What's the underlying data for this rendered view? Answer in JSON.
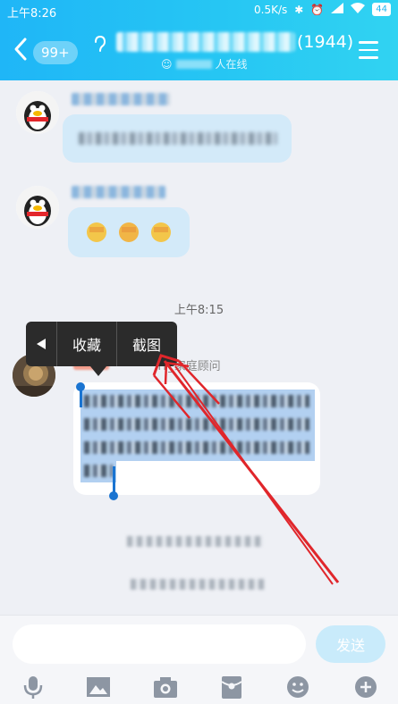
{
  "status_bar": {
    "time": "上午8:26",
    "network_speed": "0.5K/s",
    "battery": "44"
  },
  "header": {
    "back_badge": "99+",
    "member_count": "(1944)",
    "online_text": "人在线"
  },
  "chat": {
    "time_separator": "上午8:15",
    "sender_name_suffix": ":IT_家庭顾问"
  },
  "context_menu": {
    "items": [
      "收藏",
      "截图"
    ]
  },
  "input_bar": {
    "placeholder": "",
    "send_label": "发送"
  },
  "icons": {
    "tools": [
      "microphone-icon",
      "image-icon",
      "camera-icon",
      "red-packet-icon",
      "emoji-icon",
      "plus-icon"
    ]
  },
  "colors": {
    "header_start": "#1fb6f7",
    "header_end": "#31d3f2",
    "annotation_red": "#e0262b",
    "popup_bg": "#2b2b2b"
  }
}
